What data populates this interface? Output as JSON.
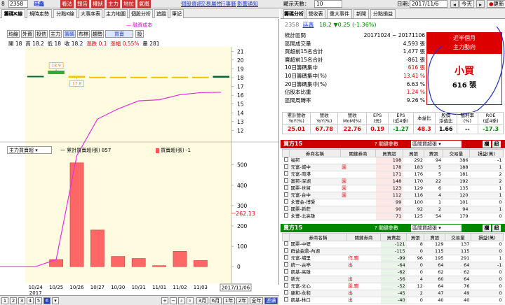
{
  "topbar": {
    "symbol_code": "8",
    "stock_code": "2358",
    "stock_name": "廷鑫",
    "buttons": [
      "看法",
      "報告",
      "權狀",
      "主力",
      "地拉",
      "氣概"
    ],
    "links": [
      "個股資訊",
      "交易屬性",
      "行事曆",
      "影響通知"
    ],
    "display_label": "顯示天數：",
    "display_value": "10",
    "date_label": "日期:",
    "date_value": "2017/11/6",
    "today_btn": "今天",
    "refresh_btn": "更新"
  },
  "left_tabs": [
    "籌碼K線",
    "規時走勢",
    "分點K線",
    "大事序表",
    "主力地圖",
    "個股分析",
    "追蹤",
    "筆記"
  ],
  "toolbar": {
    "buttons": [
      "均線",
      "外資",
      "投信",
      "主力",
      "籌碼",
      "布林",
      "趨勢",
      "買賣",
      "設"
    ],
    "ma_legend": "融資成本"
  },
  "ohlc": {
    "open_label": "開",
    "open": "18",
    "high_label": "高",
    "high": "18.2",
    "low_label": "低",
    "low": "18",
    "close_label": "收",
    "close": "18.2",
    "chg_label": "漲跌",
    "chg": "0.1",
    "pct_label": "漲幅",
    "pct": "0.55%",
    "vol_label": "量",
    "vol": "281"
  },
  "price_axis": [
    "21",
    "20",
    "19",
    "18",
    "17",
    "16",
    "15",
    "14",
    "13",
    "12"
  ],
  "price_tags": {
    "high": "18.9",
    "low": "17.8"
  },
  "lower": {
    "select": "主力買賣超",
    "legend1": "一 累計買賣超(張) 857",
    "legend2": "買賣超(張) -1",
    "axis": [
      "500",
      "400",
      "300",
      "200",
      "100",
      "0"
    ],
    "current": "262.13"
  },
  "x_dates": [
    "10/24",
    "10/25",
    "10/26",
    "10/27",
    "10/30",
    "10/31",
    "11/01",
    "11/02",
    "11/03"
  ],
  "x_year": "2017",
  "x_current": "2017/11/06",
  "bottom": {
    "pages": [
      "1",
      "2",
      "3",
      "4",
      "5",
      "6"
    ],
    "periods": [
      "3月",
      "6月",
      "1年",
      "2年",
      "全年",
      "連續"
    ]
  },
  "right": {
    "tabs": [
      "籌碼分析",
      "營收表",
      "重大事件",
      "新聞",
      "分點損益"
    ],
    "stock": "2358",
    "name": "廷鑫",
    "price": "18.2",
    "change": "▼0.25 (-1.36%)",
    "stats": [
      {
        "label": "統計區間",
        "value": "20171024 ~ 20171106",
        "color": "#000"
      },
      {
        "label": "區間成交量",
        "value": "4,593 張",
        "color": "#000"
      },
      {
        "label": "買超前15名合計",
        "value": "1,477 張",
        "color": "#000"
      },
      {
        "label": "賣超前15名合計",
        "value": "-861 張",
        "color": "#000"
      },
      {
        "label": "10日籌碼集中",
        "value": "616 張",
        "color": "#d00"
      },
      {
        "label": "10日籌碼集中(%)",
        "value": "13.41 %",
        "color": "#d00"
      },
      {
        "label": "20日籌碼集中(%)",
        "value": "6.63 %",
        "color": "#000"
      },
      {
        "label": "佔股本比重",
        "value": "1.24 %",
        "color": "#d00"
      },
      {
        "label": "區間周轉率",
        "value": "9.26 %",
        "color": "#000"
      }
    ],
    "box": {
      "line1": "近半個月",
      "line2": "主力動向",
      "main": "小買",
      "sub": "616 張"
    },
    "fin_headers": [
      "累計營收\nYoY(%)",
      "營收\nYoY(%)",
      "營收\nMoM(%)",
      "EPS\n(元)",
      "EPS\n(近4季)",
      "本益比",
      "股價\n淨值比",
      "殖利率\n(%)",
      "ROE\n(近4季)"
    ],
    "fin_values": [
      "25.01",
      "67.78",
      "22.76",
      "0.19",
      "-1.27",
      "48.3",
      "1.66",
      "--",
      "-17.3"
    ],
    "buy_title": "買方15",
    "sell_title": "賣方15",
    "rel_label": "關鍵參數",
    "rel_select": "區間買超張",
    "btn_a": "欄",
    "btn_b": "紐",
    "table_headers": [
      "券商名稱",
      "關鍵券商",
      "買賣超",
      "買張",
      "賣張",
      "交易量",
      "損益(萬)"
    ],
    "buy_rows": [
      [
        "福邦",
        "",
        "198",
        "292",
        "94",
        "386",
        "-1"
      ],
      [
        "元富-城中",
        "園",
        "178",
        "183",
        "5",
        "188",
        "1"
      ],
      [
        "元富-南港",
        "",
        "171",
        "176",
        "5",
        "181",
        "2"
      ],
      [
        "富邦-深湖",
        "園",
        "148",
        "170",
        "22",
        "192",
        "2"
      ],
      [
        "國票-世貿",
        "園",
        "123",
        "129",
        "6",
        "135",
        "1"
      ],
      [
        "元富-台中",
        "園",
        "112",
        "116",
        "4",
        "120",
        "1"
      ],
      [
        "永豐金-博愛",
        "",
        "99",
        "100",
        "1",
        "101",
        "0"
      ],
      [
        "國票-新莊",
        "",
        "90",
        "92",
        "2",
        "94",
        "1"
      ],
      [
        "永豐-北高雄",
        "",
        "71",
        "125",
        "54",
        "179",
        "0"
      ]
    ],
    "sell_rows": [
      [
        "國票-中壢",
        "",
        "-121",
        "8",
        "129",
        "137",
        "0"
      ],
      [
        "群益金鼎-內湖",
        "",
        "-115",
        "0",
        "115",
        "115",
        "0"
      ],
      [
        "元富-埔里",
        "作,駒",
        "-99",
        "96",
        "195",
        "291",
        "1"
      ],
      [
        "統一-古亭",
        "出",
        "-64",
        "0",
        "64",
        "64",
        "-1"
      ],
      [
        "凱基-高雄",
        "",
        "-62",
        "0",
        "62",
        "62",
        "0"
      ],
      [
        "新光",
        "出",
        "-56",
        "4",
        "60",
        "64",
        "0"
      ],
      [
        "元富-文心",
        "園,駒",
        "-52",
        "12",
        "64",
        "76",
        "0"
      ],
      [
        "康和-永和",
        "出",
        "-45",
        "2",
        "47",
        "49",
        "0"
      ],
      [
        "凱基-林口",
        "出",
        "-40",
        "0",
        "40",
        "40",
        "0"
      ]
    ]
  },
  "chart_data": [
    {
      "type": "bar",
      "title": "",
      "categories": [
        "10/24",
        "10/25",
        "10/26",
        "10/27",
        "10/30",
        "10/31",
        "11/01",
        "11/02",
        "11/03",
        "11/06"
      ],
      "candles": [
        {
          "open": 18.2,
          "close": 18.2,
          "high": 18.2,
          "low": 18.2
        },
        {
          "open": 18.4,
          "close": 18.8,
          "high": 18.9,
          "low": 18.4
        },
        {
          "open": 18.2,
          "close": 18.0,
          "high": 18.2,
          "low": 17.8
        },
        {
          "open": 18.1,
          "close": 18.0,
          "high": 18.1,
          "low": 18.0
        },
        {
          "open": 18.1,
          "close": 18.0,
          "high": 18.1,
          "low": 18.0
        },
        {
          "open": 18.1,
          "close": 18.0,
          "high": 18.1,
          "low": 18.0
        },
        {
          "open": 18.1,
          "close": 18.0,
          "high": 18.1,
          "low": 18.0
        },
        {
          "open": 18.1,
          "close": 18.0,
          "high": 18.1,
          "low": 18.0
        },
        {
          "open": 18.1,
          "close": 18.0,
          "high": 18.1,
          "low": 18.0
        },
        {
          "open": 18.0,
          "close": 18.2,
          "high": 18.2,
          "low": 18.0
        }
      ],
      "ylim": [
        11,
        21.5
      ]
    },
    {
      "type": "bar",
      "categories": [
        "10/24",
        "10/25",
        "10/26",
        "10/27",
        "10/30",
        "10/31",
        "11/01",
        "11/02",
        "11/03",
        "11/06"
      ],
      "series": [
        {
          "name": "買賣超(張)",
          "values": [
            0,
            35,
            510,
            180,
            50,
            40,
            5,
            75,
            30,
            -1
          ]
        },
        {
          "name": "累計買賣超(張)",
          "values": [
            0,
            35,
            545,
            725,
            775,
            815,
            820,
            845,
            855,
            857
          ]
        }
      ],
      "ylim": [
        -20,
        530
      ]
    }
  ]
}
